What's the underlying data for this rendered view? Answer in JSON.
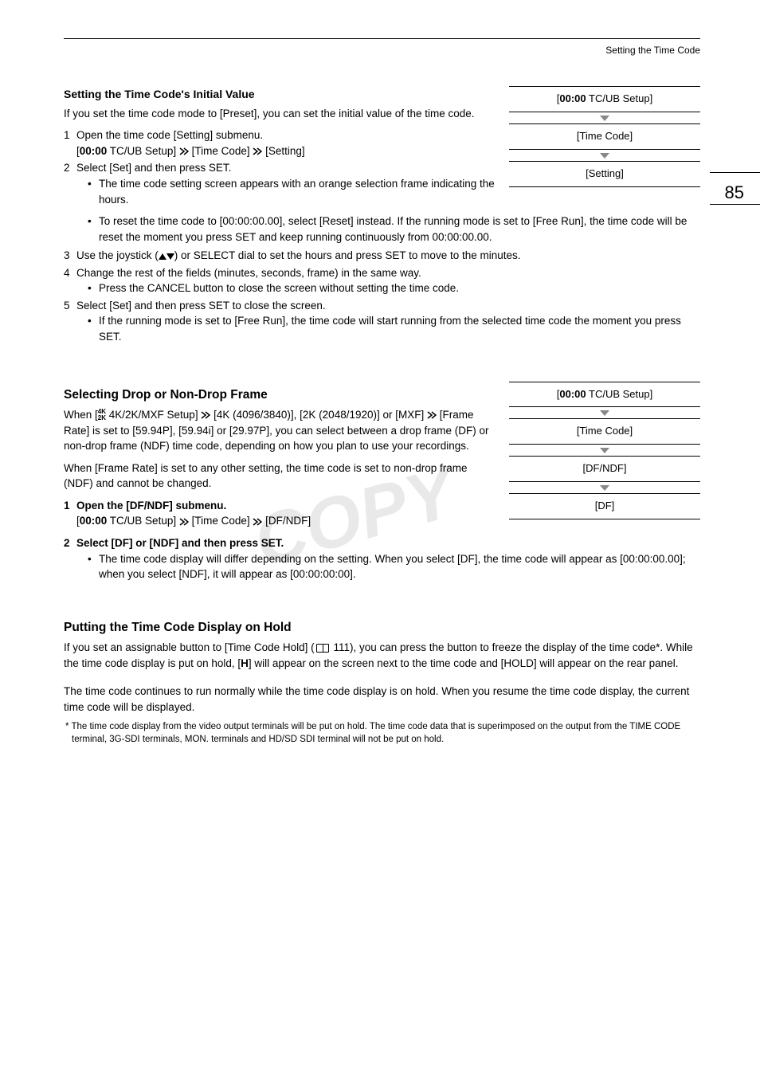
{
  "header": {
    "breadcrumb": "Setting the Time Code",
    "page_number": "85"
  },
  "section1": {
    "title": "Setting the Time Code's Initial Value",
    "intro": "If you set the time code mode to [Preset], you can set the initial value of the time code.",
    "menu": {
      "level1_prefix": "00:00",
      "level1_label": " TC/UB Setup]",
      "level2": "[Time Code]",
      "level3": "[Setting]"
    },
    "steps": {
      "s1": "Open the time code [Setting] submenu.",
      "s1_path_a": "00:00",
      "s1_path_b": " TC/UB Setup] ",
      "s1_path_c": " [Time Code] ",
      "s1_path_d": " [Setting]",
      "s2": "Select [Set] and then press SET.",
      "s2_b1": "The time code setting screen appears with an orange selection frame indicating the hours.",
      "s2_b2": "To reset the time code to [00:00:00.00], select [Reset] instead. If the running mode is set to [Free Run], the time code will be reset the moment you press SET and keep running continuously from 00:00:00.00.",
      "s3_a": "Use the joystick (",
      "s3_b": ") or SELECT dial to set the hours and press SET to move to the minutes.",
      "s4": "Change the rest of the fields (minutes, seconds, frame) in the same way.",
      "s4_b1": "Press the CANCEL button to close the screen without setting the time code.",
      "s5": "Select [Set] and then press SET to close the screen.",
      "s5_b1": "If the running mode is set to [Free Run], the time code will start running from the selected time code the moment you press SET."
    }
  },
  "section2": {
    "title": "Selecting Drop or Non-Drop Frame",
    "intro_a": "When [",
    "intro_a2": " 4K/2K/MXF Setup] ",
    "intro_a3": " [4K (4096/3840)], [2K (2048/1920)] or [MXF] ",
    "intro_a4": " [Frame Rate] is set to [59.94P], [59.94i] or [29.97P], you can select between a drop frame (DF) or non-drop frame (NDF) time code, depending on how you plan to use your recordings.",
    "intro_b": "When [Frame Rate] is set to any other setting, the time code is set to non-drop frame (NDF) and cannot be changed.",
    "menu": {
      "level1_prefix": "00:00",
      "level1_label": " TC/UB Setup]",
      "level2": "[Time Code]",
      "level3": "[DF/NDF]",
      "level4": "[DF]"
    },
    "steps": {
      "s1": "Open the [DF/NDF] submenu.",
      "s1_path_a": "00:00",
      "s1_path_b": " TC/UB Setup] ",
      "s1_path_c": " [Time Code] ",
      "s1_path_d": " [DF/NDF]",
      "s2": "Select [DF] or [NDF] and then press SET.",
      "s2_b1": "The time code display will differ depending on the setting. When you select [DF], the time code will appear as [00:00:00.00]; when you select [NDF], it will appear as [00:00:00:00]."
    }
  },
  "section3": {
    "title": "Putting the Time Code Display on Hold",
    "para1_a": "If you set an assignable button to [Time Code Hold] (",
    "para1_b": " 111), you can press the button to freeze the display of the time code*. While the time code display is put on hold, [",
    "para1_c": "H",
    "para1_d": "] will appear on the screen next to the time code and [HOLD] will appear on the rear panel.",
    "para2": "The time code continues to run normally while the time code display is on hold. When you resume the time code display, the current time code will be displayed.",
    "footnote": "* The time code display from the video output terminals will be put on hold. The time code data that is superimposed on the output from the TIME CODE terminal, 3G-SDI terminals, MON. terminals and HD/SD SDI terminal will not be put on hold."
  }
}
